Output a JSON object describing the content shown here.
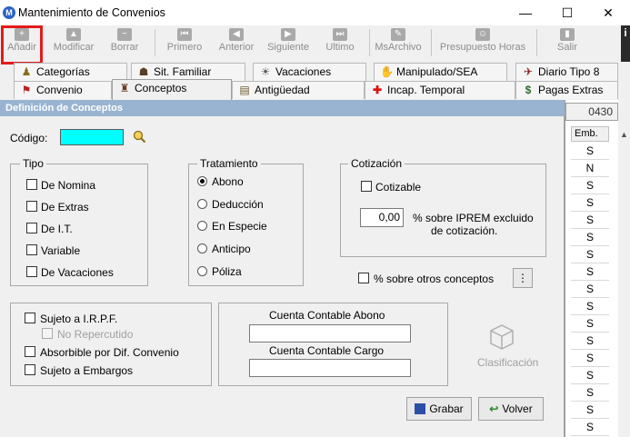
{
  "window": {
    "title": "Mantenimiento de Convenios",
    "app_icon": "M",
    "minimize": "—",
    "maximize": "☐",
    "close": "✕"
  },
  "toolbar": {
    "items": [
      {
        "label": "Añadir",
        "icon": "plus-icon",
        "glyph": "+"
      },
      {
        "label": "Modificar",
        "icon": "up-arrow-icon",
        "glyph": "▲"
      },
      {
        "label": "Borrar",
        "icon": "minus-icon",
        "glyph": "−"
      },
      {
        "label": "Primero",
        "icon": "first-icon",
        "glyph": "⏮"
      },
      {
        "label": "Anterior",
        "icon": "previous-icon",
        "glyph": "◀"
      },
      {
        "label": "Siguiente",
        "icon": "next-icon",
        "glyph": "▶"
      },
      {
        "label": "Ultimo",
        "icon": "last-icon",
        "glyph": "⏭"
      },
      {
        "label": "MsArchivo",
        "icon": "paperclip-icon",
        "glyph": "✎"
      },
      {
        "label": "Presupuesto Horas",
        "icon": "people-icon",
        "glyph": "☺"
      },
      {
        "label": "Salir",
        "icon": "exit-icon",
        "glyph": "▮"
      }
    ],
    "info": "i"
  },
  "tabs": {
    "row1": [
      {
        "label": "Categorías",
        "glyph": "♟",
        "color": "#8a6d1f"
      },
      {
        "label": "Sit. Familiar",
        "glyph": "☗",
        "color": "#5a4020"
      },
      {
        "label": "Vacaciones",
        "glyph": "☀",
        "color": "#555555"
      },
      {
        "label": "Manipulado/SEA",
        "glyph": "✋",
        "color": "#7a3b2e"
      },
      {
        "label": "Diario Tipo 8",
        "glyph": "✈",
        "color": "#8b1a1a"
      }
    ],
    "row2": [
      {
        "label": "Convenio",
        "glyph": "⚑",
        "color": "#b5231b"
      },
      {
        "label": "Conceptos",
        "glyph": "♜",
        "color": "#6b3a1e"
      },
      {
        "label": "Antigüedad",
        "glyph": "▤",
        "color": "#6a5a2a"
      },
      {
        "label": "Incap. Temporal",
        "glyph": "✚",
        "color": "#e01010"
      },
      {
        "label": "Pagas Extras",
        "glyph": "$",
        "color": "#2e6b2e"
      }
    ]
  },
  "dialog": {
    "header": "Definición de Conceptos",
    "codigo_label": "Código:",
    "codigo_value": "",
    "tipo": {
      "legend": "Tipo",
      "options": [
        "De Nomina",
        "De Extras",
        "De I.T.",
        "Variable",
        "De Vacaciones"
      ]
    },
    "tratamiento": {
      "legend": "Tratamiento",
      "options": [
        "Abono",
        "Deducción",
        "En Especie",
        "Anticipo",
        "Póliza"
      ],
      "selected": "Abono"
    },
    "cotizacion": {
      "legend": "Cotización",
      "cotizable": "Cotizable",
      "value": "0,00",
      "desc_line1": "% sobre IPREM excluido",
      "desc_line2": "de cotización."
    },
    "otros_conceptos": "% sobre otros conceptos",
    "otros_btn": "⋮",
    "irpf": {
      "sujeto": "Sujeto a I.R.P.F.",
      "no_repercutido": "No Repercutido",
      "absorbible": "Absorbible por Dif. Convenio",
      "embargos": "Sujeto a Embargos"
    },
    "cuentas": {
      "abono_label": "Cuenta Contable Abono",
      "abono_value": "",
      "cargo_label": "Cuenta Contable Cargo",
      "cargo_value": ""
    },
    "clasificacion": "Clasificación",
    "grabar": "Grabar",
    "volver": "Volver"
  },
  "right_panel": {
    "code": "0430",
    "column_header": "Emb.",
    "values": [
      "S",
      "N",
      "S",
      "S",
      "S",
      "S",
      "S",
      "S",
      "S",
      "S",
      "S",
      "S",
      "S",
      "S",
      "S",
      "S",
      "S"
    ]
  },
  "colors": {
    "header_bar": "#99b4d1",
    "highlight": "#e31b1b",
    "codigo_field": "#00ffff"
  }
}
